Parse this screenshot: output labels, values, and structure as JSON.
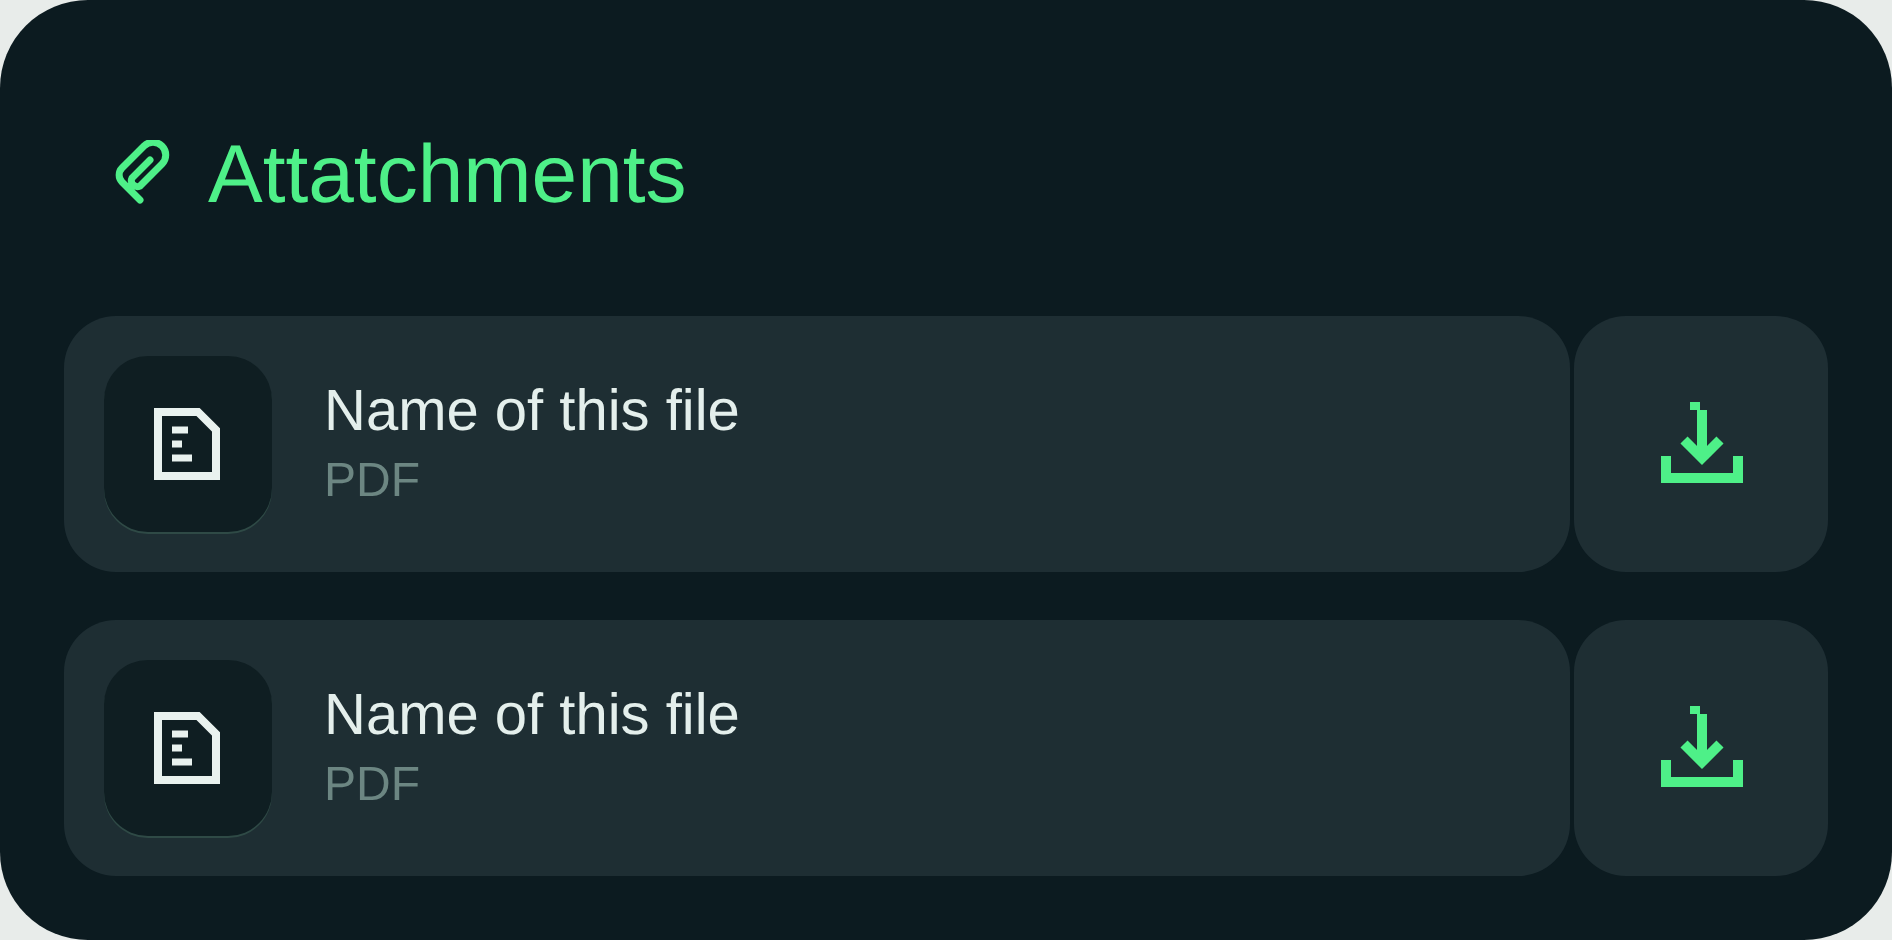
{
  "title": "Attatchments",
  "files": [
    {
      "name": "Name of this file",
      "type": "PDF"
    },
    {
      "name": "Name of this file",
      "type": "PDF"
    }
  ]
}
